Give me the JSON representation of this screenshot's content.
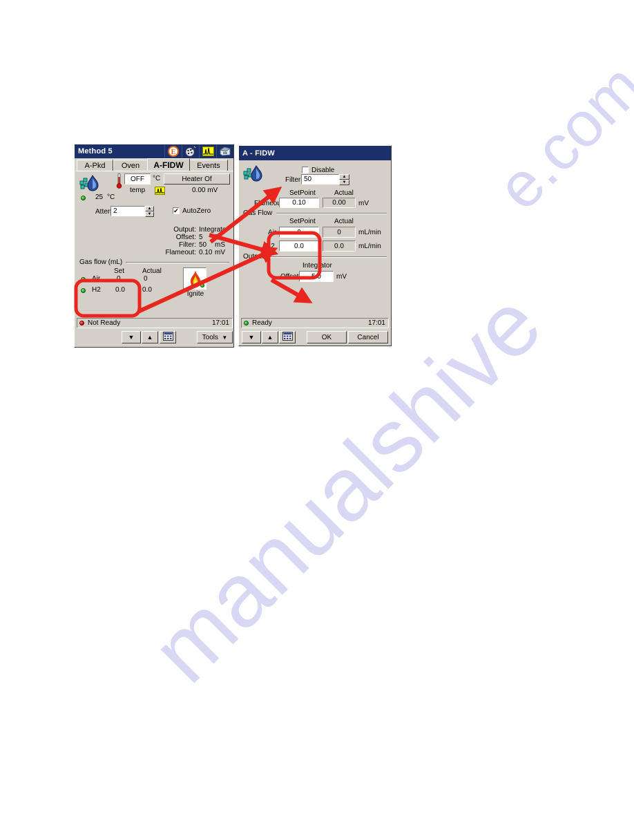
{
  "watermark": {
    "top_text": "e.com",
    "bottom_text": "manualshive"
  },
  "left_panel": {
    "title": "Method 5",
    "title_icons": [
      "edit-method-icon",
      "palette-wand-icon",
      "chromatogram-icon",
      "instrument-icon"
    ],
    "tabs": [
      {
        "label": "A-Pkd",
        "active": false
      },
      {
        "label": "Oven",
        "active": false
      },
      {
        "label": "A-FIDW",
        "active": true
      },
      {
        "label": "Events",
        "active": false
      }
    ],
    "detector_icon": "fid-detector-icon",
    "temperature": {
      "thermometer_icon": "thermometer-icon",
      "setpoint_value": "OFF",
      "unit": "°C",
      "sub_label": "temp",
      "heater_button": "Heater Of",
      "signal_icon": "chromatogram-icon",
      "signal_value": "0.00  mV",
      "actual_value": "25",
      "actual_unit": "°C"
    },
    "atten": {
      "label": "Atten",
      "value": "2"
    },
    "autozero": {
      "label": "AutoZero",
      "checked": true
    },
    "readout": [
      {
        "label": "Output:",
        "value": "Integrator",
        "unit": ""
      },
      {
        "label": "Offset:",
        "value": "5",
        "unit": "%"
      },
      {
        "label": "Filter:",
        "value": "50",
        "unit": "mS"
      },
      {
        "label": "Flameout:",
        "value": "0.10",
        "unit": "mV"
      }
    ],
    "gas_flow": {
      "group_label": "Gas flow (mL)",
      "col_set": "Set",
      "col_actual": "Actual",
      "rows": [
        {
          "name": "Air",
          "set": "0",
          "actual": "0"
        },
        {
          "name": "H2",
          "set": "0.0",
          "actual": "0.0"
        }
      ]
    },
    "ignite": {
      "label": "Ignite",
      "icon": "flame-icon"
    },
    "status": {
      "text": "Not Ready",
      "led": "red",
      "time": "17:01"
    },
    "toolbar": {
      "down_arrow": "▼",
      "up_arrow": "▲",
      "keypad_icon": "keypad-icon",
      "tools_label": "Tools",
      "tools_arrow": "▼"
    }
  },
  "right_panel": {
    "title": "A - FIDW",
    "detector_icon": "fid-detector-icon",
    "disable": {
      "label": "Disable",
      "checked": false
    },
    "filter": {
      "label": "Filter",
      "value": "50"
    },
    "flameout": {
      "col_setpoint": "SetPoint",
      "col_actual": "Actual",
      "label": "Flameout",
      "setpoint": "0.10",
      "actual": "0.00",
      "unit": "mV"
    },
    "gas_flow": {
      "group_label": "Gas Flow",
      "col_setpoint": "SetPoint",
      "col_actual": "Actual",
      "rows": [
        {
          "name": "Air",
          "setpoint": "0",
          "actual": "0",
          "unit": "mL/min"
        },
        {
          "name": "H2",
          "setpoint": "0.0",
          "actual": "0.0",
          "unit": "mL/min"
        }
      ]
    },
    "output": {
      "group_label": "Output",
      "mode_label": "Integrator",
      "offset_label": "Offset",
      "offset_value": "5.0",
      "unit": "mV"
    },
    "status": {
      "text": "Ready",
      "led": "green",
      "time": "17:01"
    },
    "buttons": {
      "down_arrow": "▼",
      "up_arrow": "▲",
      "keypad_icon": "keypad-icon",
      "ok_label": "OK",
      "cancel_label": "Cancel"
    }
  },
  "annotations": {
    "accent_color": "#e8251f",
    "highlight_boxes": [
      "left-gasflow-highlight",
      "right-gasflow-highlight"
    ],
    "arrow_count": 4
  }
}
